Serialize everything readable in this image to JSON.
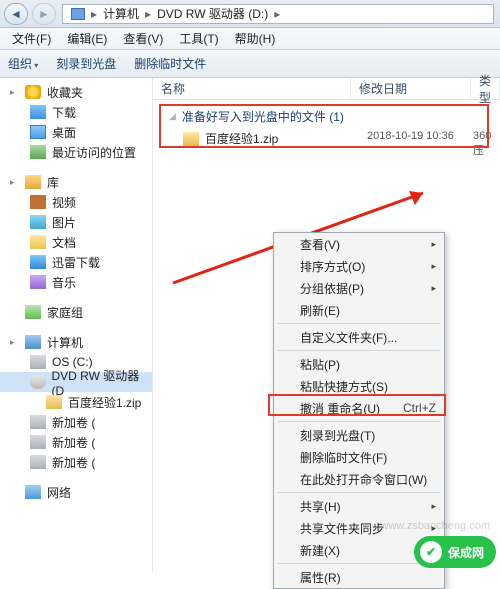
{
  "titlebar": {
    "breadcrumb": [
      "计算机",
      "DVD RW 驱动器 (D:)"
    ]
  },
  "menubar": [
    "文件(F)",
    "编辑(E)",
    "查看(V)",
    "工具(T)",
    "帮助(H)"
  ],
  "toolbar": {
    "organize": "组织",
    "burn": "刻录到光盘",
    "delete_temp": "删除临时文件"
  },
  "columns": {
    "name": "名称",
    "modified": "修改日期",
    "type": "类型"
  },
  "section_title": "准备好写入到光盘中的文件 (1)",
  "file": {
    "name": "百度经验1.zip",
    "date": "2018-10-19 10:36",
    "ext": "360压"
  },
  "sidebar": {
    "favorites": "收藏夹",
    "downloads": "下载",
    "desktop": "桌面",
    "recent": "最近访问的位置",
    "library": "库",
    "video": "视频",
    "pictures": "图片",
    "documents": "文档",
    "xunlei": "迅雷下载",
    "music": "音乐",
    "homegroup": "家庭组",
    "computer": "计算机",
    "os": "OS (C:)",
    "dvd": "DVD RW 驱动器 (D",
    "zipfile": "百度经验1.zip",
    "newvol1": "新加卷 (",
    "newvol2": "新加卷 (",
    "newvol3": "新加卷 (",
    "network": "网络"
  },
  "context_menu": {
    "view": "查看(V)",
    "sort": "排序方式(O)",
    "group": "分组依据(P)",
    "refresh": "刷新(E)",
    "customize": "自定义文件夹(F)...",
    "paste": "粘贴(P)",
    "paste_shortcut": "粘贴快捷方式(S)",
    "undo_rename": "撤消 重命名(U)",
    "undo_shortcut": "Ctrl+Z",
    "burn": "刻录到光盘(T)",
    "delete_temp": "删除临时文件(F)",
    "open_cmd": "在此处打开命令窗口(W)",
    "share": "共享(H)",
    "sync": "共享文件夹同步",
    "new": "新建(X)",
    "properties": "属性(R)"
  },
  "watermark": {
    "url": "www.zsbaocheng.com",
    "brand": "保成网"
  }
}
